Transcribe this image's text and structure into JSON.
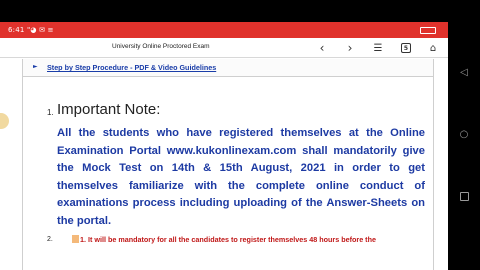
{
  "status_bar": {
    "text": "6:41 \"◕ ✉ ≡"
  },
  "browser": {
    "title": "University Online Proctored Exam",
    "icons": {
      "back": "chevron-left-icon",
      "forward": "chevron-right-icon",
      "bookmark": "bookmark-list-icon",
      "tabs": "tabs-icon",
      "home": "home-icon"
    },
    "tabs_count": "5",
    "back_glyph": "‹",
    "forward_glyph": "›",
    "bookmark_glyph": "☰",
    "home_glyph": "⌂"
  },
  "page": {
    "procedure_link": "Step by Step Procedure - PDF & Video Guidelines",
    "procedure_arrow": "►",
    "item1_number": "1.",
    "item1_heading": "Important Note:",
    "item1_body": "All the students who have registered themselves at the Online Examination Portal www.kukonlinexam.com shall mandatorily give the Mock Test on 14th & 15th August, 2021 in order to get themselves familiarize with the complete online conduct of examinations process including uploading of the Answer-Sheets on the portal.",
    "item2_number": "2.",
    "item2_text": "1. It will be mandatory for all the candidates to register themselves 48 hours before the"
  },
  "nav_bar": {
    "back_glyph": "◁",
    "home_glyph": "○"
  },
  "colors": {
    "status_bar": "#e0322c",
    "link_blue": "#1a3da8",
    "body_blue": "#1d3aa3",
    "warning_red": "#c01818"
  }
}
